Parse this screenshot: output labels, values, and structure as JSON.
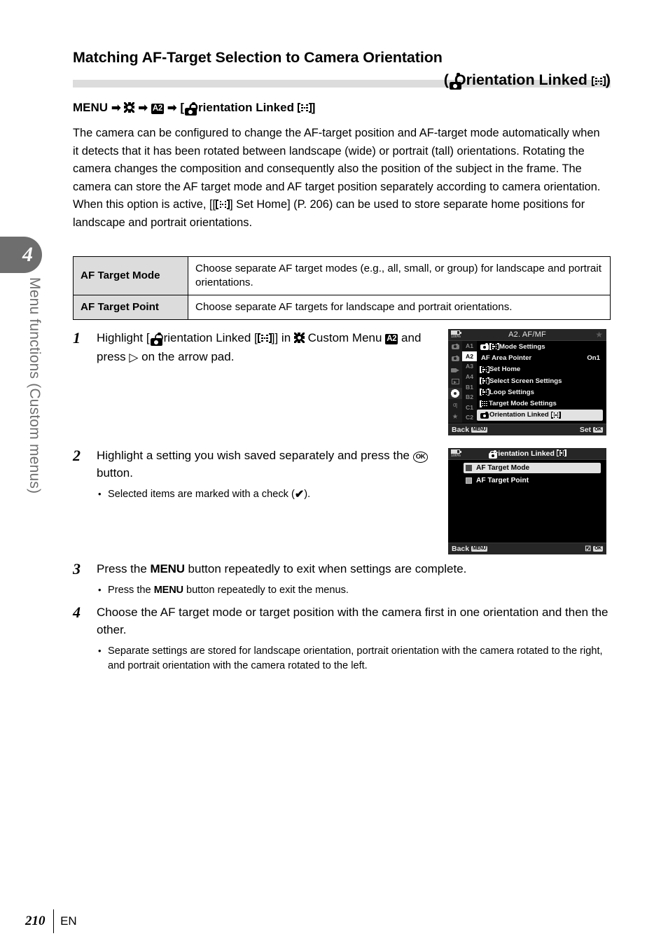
{
  "chapter": {
    "number": "4",
    "vertical_title": "Menu functions (Custom menus)"
  },
  "header": {
    "title_line1": "Matching AF-Target Selection to Camera Orientation",
    "title_line2_prefix": "(",
    "title_line2_text": "Orientation Linked",
    "title_line2_suffix": ")",
    "menu_path_label": "MENU",
    "menu_path_item": "Orientation Linked"
  },
  "intro": {
    "part1": "The camera can be configured to change the AF-target position and AF-target mode automatically when it detects that it has been rotated between landscape (wide) or portrait (tall) orientations. Rotating the camera changes the composition and consequently also the position of the subject in the frame. The camera can store the AF target mode and AF target position separately according to camera orientation. When this option is active, [[",
    "part2": "] Set Home] (P. 206) can be used to store separate home positions for landscape and portrait orientations."
  },
  "table": {
    "rows": [
      {
        "label": "AF Target Mode",
        "description": "Choose separate AF target modes (e.g., all, small, or group) for landscape and portrait orientations."
      },
      {
        "label": "AF Target Point",
        "description": "Choose separate AF targets for landscape and portrait orientations."
      }
    ]
  },
  "steps": {
    "step1": {
      "number": "1",
      "text_a": "Highlight [",
      "text_b": "Orientation Linked [",
      "text_c": "]] in",
      "text_d": "Custom Menu",
      "badge": "A2",
      "text_e": "and press",
      "text_f": "on the arrow pad."
    },
    "step2": {
      "number": "2",
      "text_a": "Highlight a setting you wish saved separately and press the",
      "ok_label": "OK",
      "text_b": "button.",
      "bullet_a": "Selected items are marked with a check (",
      "bullet_b": ")."
    },
    "step3": {
      "number": "3",
      "text_a": "Press the",
      "menu_label": "MENU",
      "text_b": "button repeatedly to exit when settings are complete.",
      "bullet_a": "Press the",
      "bullet_menu": "MENU",
      "bullet_b": "button repeatedly to exit the menus."
    },
    "step4": {
      "number": "4",
      "text": "Choose the AF target mode or target position with the camera first in one orientation and then the other.",
      "bullet": "Separate settings are stored for landscape orientation, portrait orientation with the camera rotated to the right, and portrait orientation with the camera rotated to the left."
    }
  },
  "lcd1": {
    "battery_pct": "100%",
    "title": "A2. AF/MF",
    "star": "★",
    "tabs": [
      {
        "icon": "camera1-icon",
        "glyph": "■",
        "selected": false
      },
      {
        "icon": "camera2-icon",
        "glyph": "■",
        "selected": false
      },
      {
        "icon": "movie-icon",
        "glyph": "■",
        "selected": false
      },
      {
        "icon": "playback-icon",
        "glyph": "■",
        "selected": false
      },
      {
        "icon": "gear-icon",
        "glyph": "✻",
        "selected": true
      },
      {
        "icon": "wrench-icon",
        "glyph": "Ɣ",
        "selected": false
      },
      {
        "icon": "star-icon",
        "glyph": "★",
        "selected": false
      }
    ],
    "pages": [
      "A1",
      "A2",
      "A3",
      "A4",
      "B1",
      "B2",
      "C1",
      "C2"
    ],
    "selected_page": "A2",
    "rows": [
      {
        "icon": "camera-af-target-icon",
        "label": "Mode Settings",
        "value": "",
        "highlighted": false
      },
      {
        "icon": "none",
        "label": "AF Area Pointer",
        "value": "On1",
        "highlighted": false
      },
      {
        "icon": "af-target-icon",
        "label": "Set Home",
        "value": "",
        "highlighted": false
      },
      {
        "icon": "af-target-icon",
        "label": "Select Screen Settings",
        "value": "",
        "highlighted": false
      },
      {
        "icon": "af-target-icon",
        "label": "Loop Settings",
        "value": "",
        "highlighted": false
      },
      {
        "icon": "target-mode-grid-icon",
        "label": "Target Mode Settings",
        "value": "",
        "highlighted": false
      },
      {
        "icon": "camera-icon",
        "label": "Orientation Linked",
        "value": "",
        "highlighted": true
      }
    ],
    "back_label": "Back",
    "back_badge": "MENU",
    "set_label": "Set",
    "set_badge": "OK"
  },
  "lcd2": {
    "battery_pct": "100%",
    "title": "Orientation Linked",
    "items": [
      {
        "label": "AF Target Mode",
        "checked": true,
        "highlighted": true
      },
      {
        "label": "AF Target Point",
        "checked": false,
        "highlighted": false
      }
    ],
    "back_label": "Back",
    "back_badge": "MENU",
    "check_badge": "☑",
    "ok_badge": "OK"
  },
  "footer": {
    "page_number": "210",
    "language": "EN"
  },
  "colors": {
    "chapter_tab": "#6e6e6e",
    "rule": "#dcdcdc",
    "table_header_bg": "#dcdcdc",
    "lcd_highlight": "#e2e2e2"
  }
}
